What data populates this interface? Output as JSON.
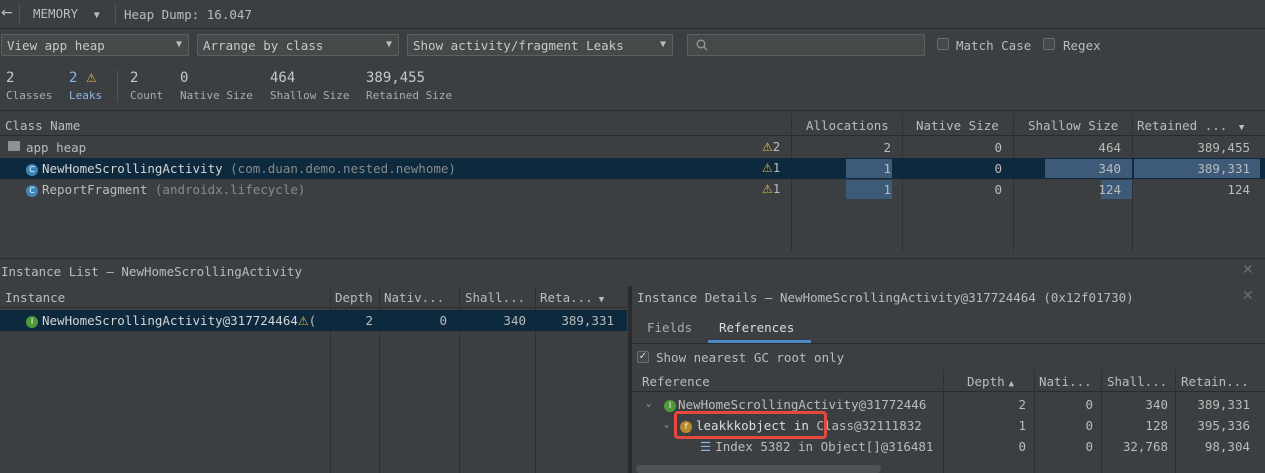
{
  "toolbar": {
    "back_glyph": "←",
    "profiler": "MEMORY",
    "dump_title": "Heap Dump: 16.047"
  },
  "filters": {
    "heap": "View app heap",
    "arrange": "Arrange by class",
    "leaks": "Show activity/fragment Leaks",
    "search_placeholder": "",
    "match_case": "Match Case",
    "regex": "Regex"
  },
  "stats": [
    {
      "value": "2",
      "label": "Classes"
    },
    {
      "value": "2",
      "label": "Leaks"
    },
    {
      "value": "2",
      "label": "Count"
    },
    {
      "value": "0",
      "label": "Native Size"
    },
    {
      "value": "464",
      "label": "Shallow Size"
    },
    {
      "value": "389,455",
      "label": "Retained Size"
    }
  ],
  "class_table": {
    "headers": [
      "Class Name",
      "Allocations",
      "Native Size",
      "Shallow Size",
      "Retained ..."
    ],
    "rows": [
      {
        "name": "app heap",
        "pkg": "",
        "leaks": "2",
        "alloc": "2",
        "native": "0",
        "shallow": "464",
        "retained": "389,455"
      },
      {
        "name": "NewHomeScrollingActivity",
        "pkg": "(com.duan.demo.nested.newhome)",
        "leaks": "1",
        "alloc": "1",
        "native": "0",
        "shallow": "340",
        "retained": "389,331"
      },
      {
        "name": "ReportFragment",
        "pkg": "(androidx.lifecycle)",
        "leaks": "1",
        "alloc": "1",
        "native": "0",
        "shallow": "124",
        "retained": "124"
      }
    ]
  },
  "instance_list": {
    "title": "Instance List – NewHomeScrollingActivity",
    "headers": [
      "Instance",
      "Depth",
      "Nativ...",
      "Shall...",
      "Reta..."
    ],
    "rows": [
      {
        "name": "NewHomeScrollingActivity@317724464",
        "tail": "(",
        "depth": "2",
        "native": "0",
        "shallow": "340",
        "retained": "389,331"
      }
    ]
  },
  "instance_details": {
    "title": "Instance Details – NewHomeScrollingActivity@317724464 (0x12f01730)",
    "tabs": [
      "Fields",
      "References"
    ],
    "gc_root_label": "Show nearest GC root only",
    "headers": [
      "Reference",
      "Depth",
      "Nati...",
      "Shall...",
      "Retain..."
    ],
    "rows": [
      {
        "name": "NewHomeScrollingActivity@31772446",
        "depth": "2",
        "native": "0",
        "shallow": "340",
        "retained": "389,331"
      },
      {
        "name": "leakkkobject in",
        "suffix": "Class@32111832",
        "depth": "1",
        "native": "0",
        "shallow": "128",
        "retained": "395,336"
      },
      {
        "name": "Index 5382 in Object[]@316481",
        "depth": "0",
        "native": "0",
        "shallow": "32,768",
        "retained": "98,304"
      }
    ]
  },
  "colors": {
    "background": "#3c3f41",
    "selection": "#0d293e",
    "highlight_box": "#e5483f",
    "warning": "#e8b53c"
  }
}
